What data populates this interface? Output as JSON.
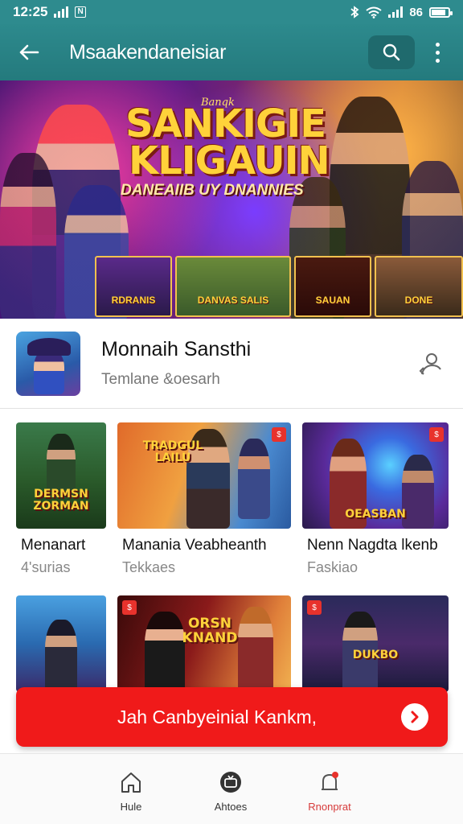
{
  "status_bar": {
    "time": "12:25",
    "notif_badge": "N",
    "battery_text": "86",
    "battery_level": 0.86
  },
  "app_bar": {
    "title": "Msaakendaneisiar"
  },
  "banner": {
    "brand": "Banqk",
    "title_line1": "SANKIGIE",
    "title_line2": "KLIGAUIN",
    "subtitle": "DANEAIIB UY DNANNIES",
    "thumbs": [
      "RDRANIS",
      "DANVAS SALIS",
      "SAUAN",
      "DONE"
    ]
  },
  "featured": {
    "title": "Monnaih Sansthi",
    "subtitle": "Temlane &oesarh"
  },
  "grid": [
    {
      "title": "Menanart",
      "subtitle": "4'surias",
      "image_text": "DERMSN ZORMAN"
    },
    {
      "title": "Manania Veabheanth",
      "subtitle": "Tekkaes",
      "image_text": "TRADGUL LAILU"
    },
    {
      "title": "Nenn Nagdta lkenb",
      "subtitle": "Faskiao",
      "image_text": "OEASBAN"
    },
    {
      "title": "",
      "subtitle": "",
      "image_text": ""
    },
    {
      "title": "",
      "subtitle": "",
      "image_text": "ORSN KNAND"
    },
    {
      "title": "",
      "subtitle": "",
      "image_text": "DUKBO"
    }
  ],
  "cta": {
    "label": "Jah Canbyeinial Kankm,"
  },
  "bottom_nav": [
    {
      "label": "Hule",
      "icon": "home-icon"
    },
    {
      "label": "Ahtoes",
      "icon": "tv-icon"
    },
    {
      "label": "Rnonprat",
      "icon": "notification-icon"
    }
  ],
  "colors": {
    "app_bar": "#2d8a8d",
    "cta": "#f01a1a",
    "active_nav": "#d63a3a"
  }
}
